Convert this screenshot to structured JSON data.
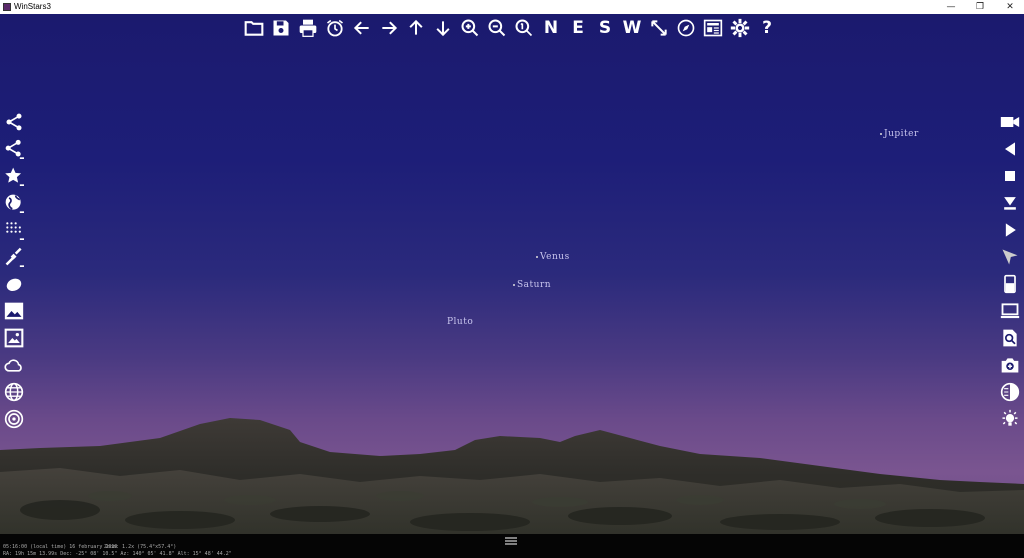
{
  "window": {
    "title": "WinStars3",
    "controls": [
      "—",
      "❐",
      "✕"
    ]
  },
  "toolbar": {
    "letters": {
      "n": "N",
      "e": "E",
      "s": "S",
      "w": "W"
    },
    "help": "?"
  },
  "sky": {
    "planets": [
      {
        "name": "Jupiter"
      },
      {
        "name": "Venus"
      },
      {
        "name": "Saturn"
      },
      {
        "name": "Pluto"
      }
    ]
  },
  "status": {
    "time": "05:16:00 (local time)  16 february 2019",
    "zoom": "Zoom: 1.2x (75.4°x57.4°)",
    "coords": "RA: 19h 15m 13.99s  Dec: -25° 08' 10.5\"  Az: 140° 05' 41.8\"  Alt: 15° 48' 44.2\""
  }
}
